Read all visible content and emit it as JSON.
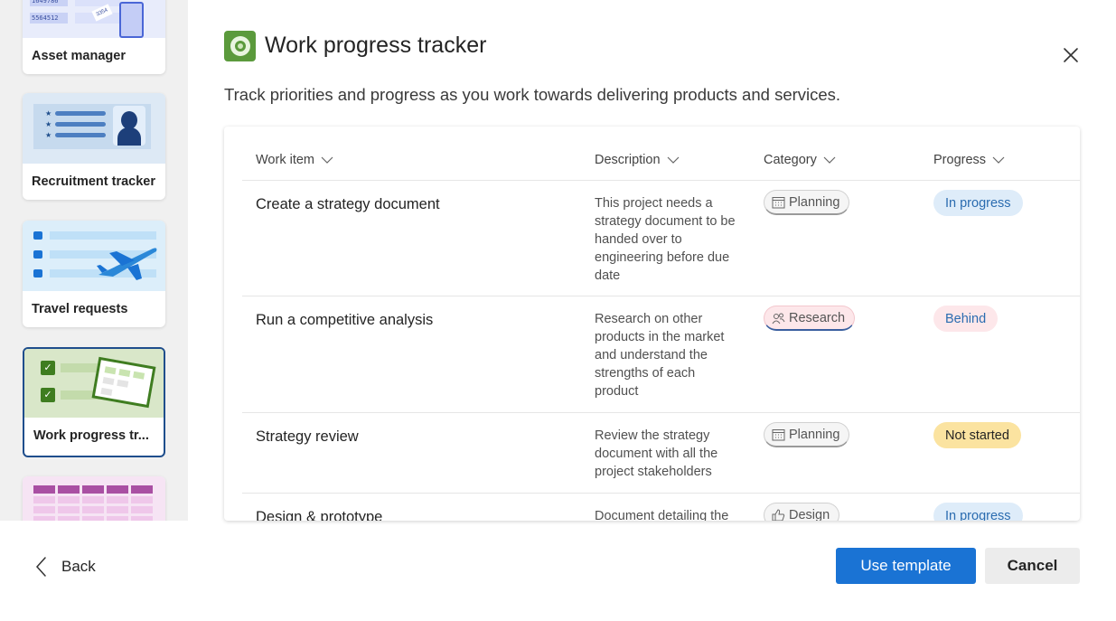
{
  "dialog": {
    "title": "Work progress tracker",
    "subtitle": "Track priorities and progress as you work towards delivering products and services."
  },
  "gallery": {
    "cards": [
      {
        "label": "Asset manager",
        "thumb_numbers": [
          "1649786",
          "5564512",
          "3354"
        ]
      },
      {
        "label": "Recruitment tracker"
      },
      {
        "label": "Travel requests"
      },
      {
        "label": "Work progress tr..."
      }
    ]
  },
  "table": {
    "columns": [
      "Work item",
      "Description",
      "Category",
      "Progress"
    ],
    "rows": [
      {
        "item": "Create a strategy document",
        "description": "This project needs a strategy document to be handed over to engineering before due date",
        "category": "Planning",
        "category_icon": "calendar-icon",
        "progress": "In progress",
        "progress_color": "#deecf9",
        "progress_text_color": "#2b6cb0"
      },
      {
        "item": "Run a competitive analysis",
        "description": "Research on other products in the market and understand the strengths of each product",
        "category": "Research",
        "category_icon": "people-icon",
        "progress": "Behind",
        "progress_color": "#fde7ea",
        "progress_text_color": "#2b6cb0"
      },
      {
        "item": "Strategy review",
        "description": "Review the strategy document with all the project stakeholders",
        "category": "Planning",
        "category_icon": "calendar-icon",
        "progress": "Not started",
        "progress_color": "#fbe3a0",
        "progress_text_color": "#242424"
      },
      {
        "item": "Design & prototype",
        "description": "Document detailing the",
        "category": "Design",
        "category_icon": "thumbs-up-icon",
        "progress": "In progress",
        "progress_color": "#deecf9",
        "progress_text_color": "#2b6cb0"
      }
    ]
  },
  "footer": {
    "back_label": "Back",
    "use_template_label": "Use template",
    "cancel_label": "Cancel"
  },
  "colors": {
    "accent": "#1a73d4",
    "app_icon": "#5b9a3c",
    "selected_border": "#1f4e8c"
  }
}
